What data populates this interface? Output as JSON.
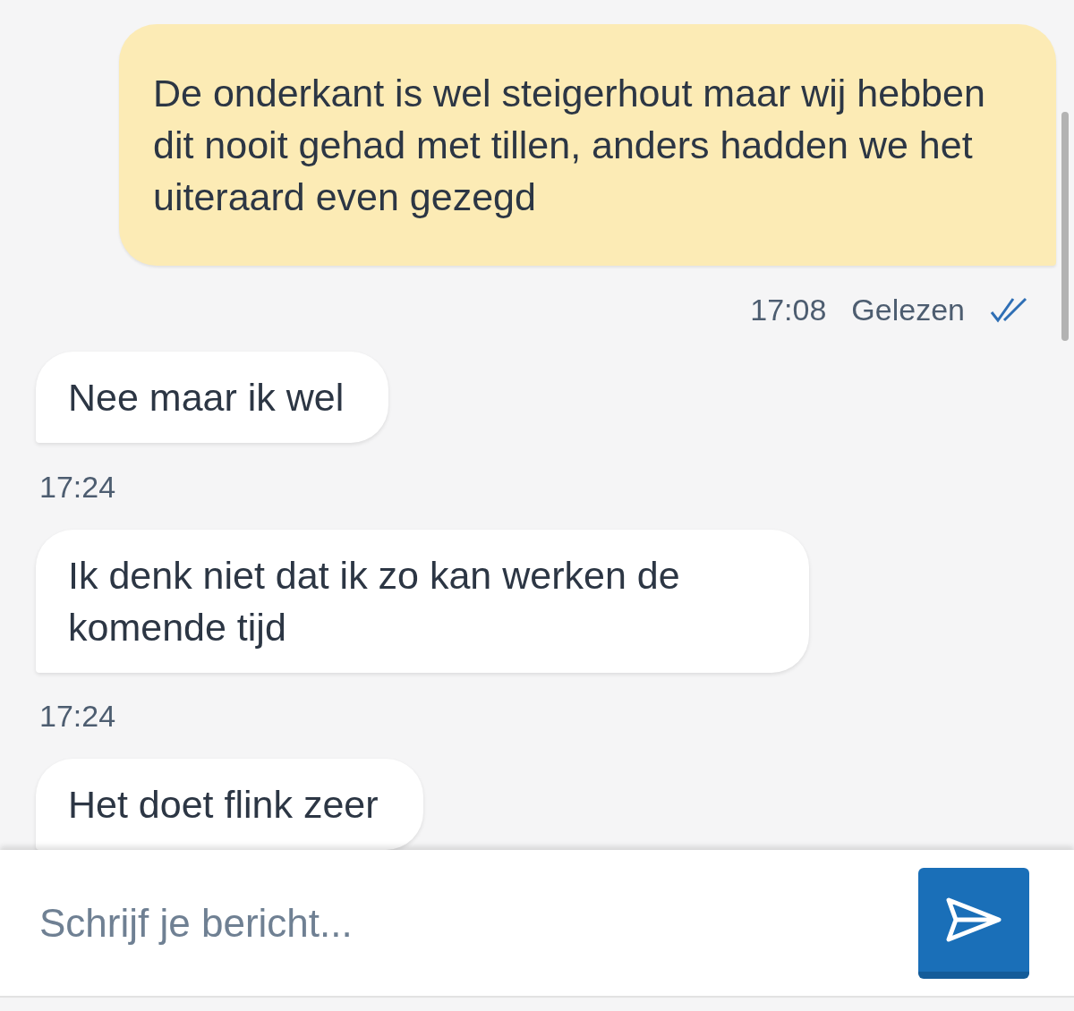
{
  "messages": [
    {
      "kind": "sent",
      "text": "De onderkant is wel steigerhout maar wij hebben dit nooit gehad met tillen, anders hadden we het uiteraard even gezegd",
      "time": "17:08",
      "status": "Gelezen",
      "read": true
    },
    {
      "kind": "received",
      "text": "Nee maar ik wel",
      "time": "17:24"
    },
    {
      "kind": "received",
      "text": "Ik denk niet dat ik zo kan werken de komende tijd",
      "time": "17:24"
    },
    {
      "kind": "received",
      "text": "Het doet flink zeer"
    }
  ],
  "composer": {
    "placeholder": "Schrijf je bericht..."
  }
}
